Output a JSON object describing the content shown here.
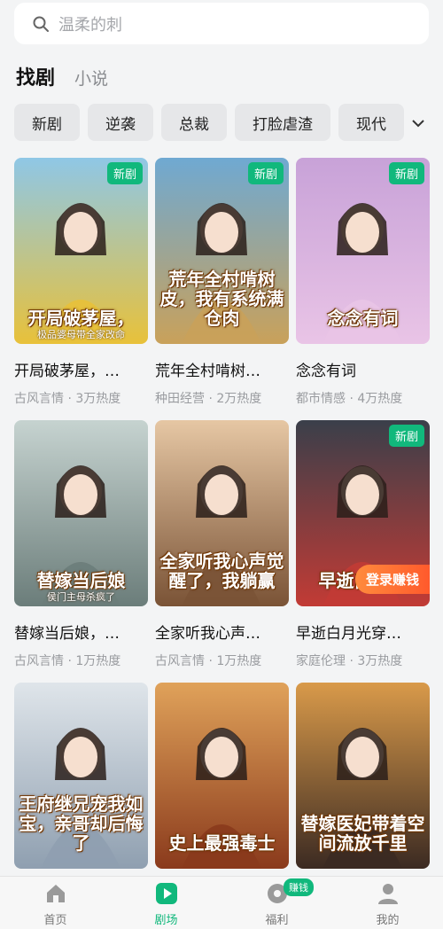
{
  "search": {
    "placeholder": "温柔的刺"
  },
  "top_tabs": [
    {
      "label": "找剧",
      "active": true
    },
    {
      "label": "小说",
      "active": false
    }
  ],
  "chips": [
    "新剧",
    "逆袭",
    "总裁",
    "打脸虐渣",
    "现代"
  ],
  "badges": {
    "new": "新剧",
    "login_earn": "登录赚钱"
  },
  "dramas": [
    {
      "title": "开局破茅屋，…",
      "genre": "古风言情",
      "heat": "3万热度",
      "is_new": true,
      "poster_text": "开局破茅屋，",
      "poster_sub": "极品婆母带全家改命",
      "colors": [
        "#e8c13a",
        "#8fc7e6"
      ]
    },
    {
      "title": "荒年全村啃树…",
      "genre": "种田经营",
      "heat": "2万热度",
      "is_new": true,
      "poster_text": "荒年全村啃树皮，我有系统满仓肉",
      "poster_sub": "",
      "colors": [
        "#c9a15a",
        "#6fa9d2"
      ]
    },
    {
      "title": "念念有词",
      "genre": "都市情感",
      "heat": "4万热度",
      "is_new": true,
      "poster_text": "念念有词",
      "poster_sub": "",
      "colors": [
        "#e9c4e6",
        "#c8a2d8"
      ]
    },
    {
      "title": "替嫁当后娘，…",
      "genre": "古风言情",
      "heat": "1万热度",
      "is_new": false,
      "poster_text": "替嫁当后娘",
      "poster_sub": "侯门主母杀疯了",
      "colors": [
        "#6b7d7a",
        "#c6d3d0"
      ]
    },
    {
      "title": "全家听我心声…",
      "genre": "古风言情",
      "heat": "1万热度",
      "is_new": false,
      "poster_text": "全家听我心声觉醒了，我躺赢",
      "poster_sub": "",
      "colors": [
        "#7a5336",
        "#e6c7a4"
      ]
    },
    {
      "title": "早逝白月光穿…",
      "genre": "家庭伦理",
      "heat": "3万热度",
      "is_new": true,
      "poster_text": "早逝白月光",
      "poster_sub": "",
      "colors": [
        "#c23b35",
        "#3a3f4a"
      ],
      "login_earn": true
    },
    {
      "title": "",
      "genre": "",
      "heat": "",
      "is_new": false,
      "poster_text": "王府继兄宠我如宝，亲哥却后悔了",
      "poster_sub": "",
      "colors": [
        "#8f9fb0",
        "#dfe5ea"
      ]
    },
    {
      "title": "",
      "genre": "",
      "heat": "",
      "is_new": false,
      "poster_text": "史上最强毒士",
      "poster_sub": "",
      "colors": [
        "#8a3a1c",
        "#e0a25a"
      ]
    },
    {
      "title": "",
      "genre": "",
      "heat": "",
      "is_new": false,
      "poster_text": "替嫁医妃带着空间流放千里",
      "poster_sub": "",
      "colors": [
        "#3b2a22",
        "#d99a4a"
      ]
    }
  ],
  "tabbar": [
    {
      "label": "首页",
      "icon": "home-icon",
      "active": false
    },
    {
      "label": "剧场",
      "icon": "play-icon",
      "active": true
    },
    {
      "label": "福利",
      "icon": "coin-icon",
      "active": false,
      "badge": "赚钱"
    },
    {
      "label": "我的",
      "icon": "profile-icon",
      "active": false
    }
  ],
  "colors": {
    "accent": "#11b87c",
    "chip_bg": "#e6e7e9",
    "background": "#f3f4f5"
  }
}
